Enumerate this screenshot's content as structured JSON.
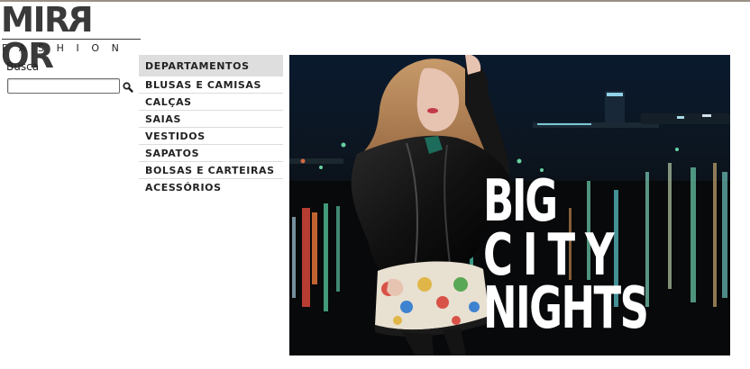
{
  "header": {
    "logo_word": "MIRROR",
    "logo_sub": "FASHION"
  },
  "search": {
    "label": "Busca",
    "value": "",
    "icon": "magnifier-icon"
  },
  "menu": {
    "heading": "DEPARTAMENTOS",
    "items": [
      "BLUSAS E CAMISAS",
      "CALÇAS",
      "SAIAS",
      "VESTIDOS",
      "SAPATOS",
      "BOLSAS E CARTEIRAS",
      "ACESSÓRIOS"
    ]
  },
  "banner": {
    "lines": [
      "BIG",
      "CITY",
      "NIGHTS"
    ],
    "text_color": "#ffffff",
    "background": "#0b0f14"
  }
}
